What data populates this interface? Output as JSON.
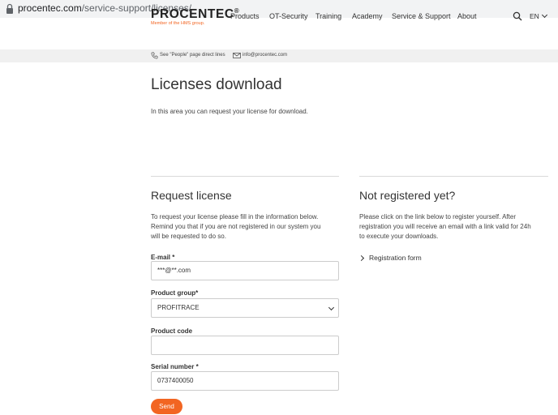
{
  "browser": {
    "url_domain": "procentec.com",
    "url_path": "/service-support/licenses/"
  },
  "header": {
    "logo_text": "PROCENTEC",
    "logo_mark": "®",
    "logo_sub": "Member of the HMS group.",
    "nav": [
      "Products",
      "OT-Security",
      "Training",
      "Academy",
      "Service & Support",
      "About"
    ],
    "language": "EN"
  },
  "contact": {
    "phone_text": "See \"People\" page direct lines",
    "email_text": "info@procentec.com"
  },
  "main": {
    "title": "Licenses download",
    "intro": "In this area you can request your license for download."
  },
  "request": {
    "title": "Request license",
    "description_lines": [
      "To request your license please fill in the information below.",
      "Remind you that if you are not registered in our system you",
      "will be requested to do so."
    ],
    "email_label": "E-mail *",
    "email_value": "***@**.com",
    "product_group_label": "Product group*",
    "product_group_value": "PROFITRACE",
    "product_code_label": "Product code",
    "product_code_value": "",
    "serial_label": "Serial number *",
    "serial_value": "0737400050",
    "send_label": "Send"
  },
  "register": {
    "title": "Not registered yet?",
    "description_lines": [
      "Please click on the link below to register yourself. After",
      "registration you will receive an email with a link valid for 24h",
      "to execute your downloads."
    ],
    "link_label": "Registration form"
  },
  "colors": {
    "accent": "#f26522",
    "text": "#333333",
    "contact_bar": "#f0f0f0"
  }
}
